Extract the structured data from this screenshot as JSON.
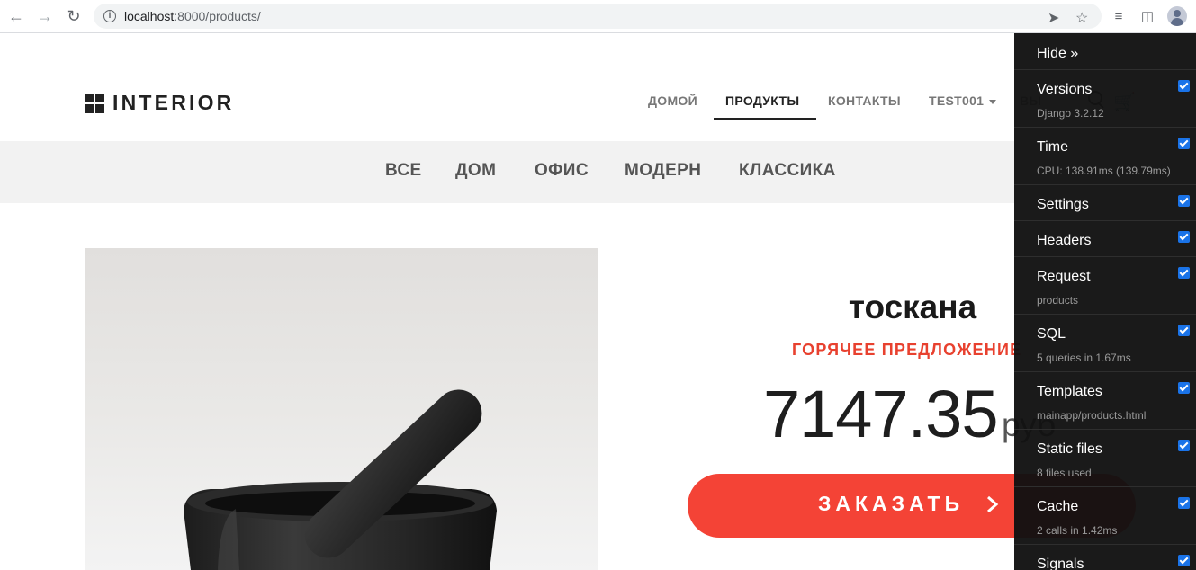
{
  "browser": {
    "url_host": "localhost",
    "url_rest": ":8000/products/"
  },
  "site": {
    "logo_text": "INTERIOR",
    "nav": {
      "home": "ДОМОЙ",
      "products": "ПРОДУКТЫ",
      "contacts": "КОНТАКТЫ",
      "user": "TEST001",
      "logout_partial": "ВЫ"
    },
    "categories": [
      "ВСЕ",
      "ДОМ",
      "ОФИС",
      "МОДЕРН",
      "КЛАССИКА"
    ]
  },
  "product": {
    "title": "тоскана",
    "hot_offer": "ГОРЯЧЕЕ ПРЕДЛОЖЕНИЕ",
    "price": "7147.35",
    "currency": "руб",
    "order_label": "ЗАКАЗАТЬ"
  },
  "debug_toolbar": {
    "hide": "Hide »",
    "panels": [
      {
        "label": "Versions",
        "sub": "Django 3.2.12",
        "checked": true
      },
      {
        "label": "Time",
        "sub": "CPU: 138.91ms (139.79ms)",
        "checked": true
      },
      {
        "label": "Settings",
        "sub": "",
        "checked": true
      },
      {
        "label": "Headers",
        "sub": "",
        "checked": true
      },
      {
        "label": "Request",
        "sub": "products",
        "checked": true
      },
      {
        "label": "SQL",
        "sub": "5 queries in 1.67ms",
        "checked": true
      },
      {
        "label": "Templates",
        "sub": "mainapp/products.html",
        "checked": true
      },
      {
        "label": "Static files",
        "sub": "8 files used",
        "checked": true
      },
      {
        "label": "Cache",
        "sub": "2 calls in 1.42ms",
        "checked": true
      },
      {
        "label": "Signals",
        "sub": "",
        "checked": true
      }
    ]
  },
  "colors": {
    "accent_red": "#f44336",
    "hot_red": "#e8412f",
    "toolbar_bg": "#111111",
    "checkbox_blue": "#1a73e8"
  }
}
